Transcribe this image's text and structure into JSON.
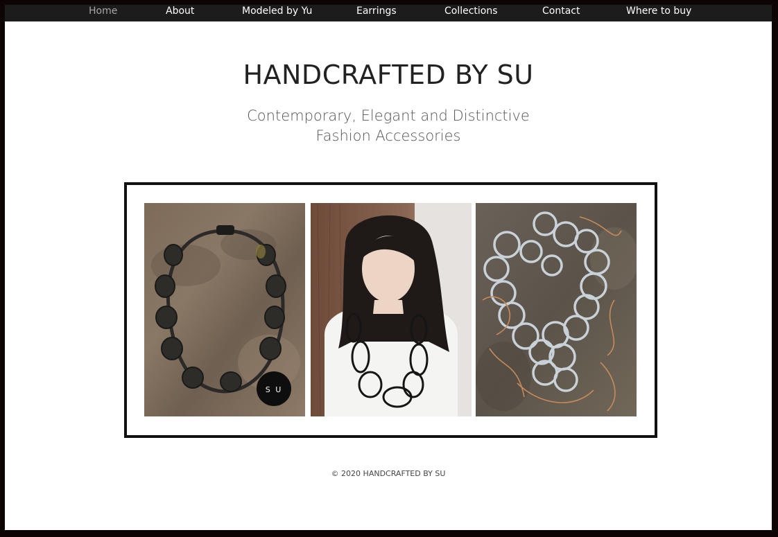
{
  "nav": {
    "items": [
      "Home",
      "About",
      "Modeled by Yu",
      "Earrings",
      "Collections",
      "Contact",
      "Where to buy"
    ],
    "active": "Home"
  },
  "header": {
    "title": "HANDCRAFTED BY SU",
    "tagline_line1": "Contemporary, Elegant and Distinctive",
    "tagline_line2": "Fashion Accessories"
  },
  "gallery": {
    "images": [
      {
        "name": "black-necklace-photo",
        "badge": "S U"
      },
      {
        "name": "model-wearing-necklace-photo"
      },
      {
        "name": "silver-copper-rings-necklace-photo"
      }
    ]
  },
  "footer": {
    "copyright": "© 2020 HANDCRAFTED BY SU"
  },
  "colors": {
    "nav_bg": "#1c1c1c",
    "nav_text": "#ffffff",
    "nav_active": "#a7a7a7",
    "outer_bg": "#0d0505",
    "title": "#222222",
    "tagline": "#555555"
  }
}
